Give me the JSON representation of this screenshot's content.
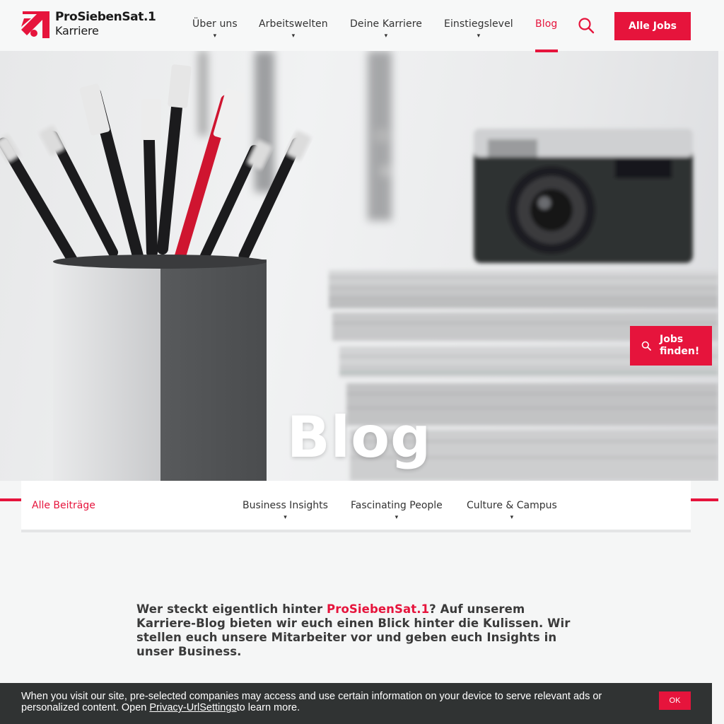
{
  "header": {
    "brand": "ProSiebenSat.1",
    "subtitle": "Karriere",
    "nav": [
      {
        "label": "Über uns",
        "caret": "▾"
      },
      {
        "label": "Arbeitswelten",
        "caret": "▾"
      },
      {
        "label": "Deine Karriere",
        "caret": "▾"
      },
      {
        "label": "Einstiegslevel",
        "caret": "▾"
      },
      {
        "label": "Blog"
      }
    ],
    "search_icon": "search-icon",
    "all_jobs": "Alle Jobs"
  },
  "hero": {
    "title": "Blog",
    "jobs_finden": "Jobs finden!"
  },
  "subnav": {
    "items": [
      {
        "label": "Alle Beiträge"
      },
      {
        "label": "Business Insights",
        "caret": "▾"
      },
      {
        "label": "Fascinating People",
        "caret": "▾"
      },
      {
        "label": "Culture & Campus",
        "caret": "▾"
      }
    ]
  },
  "intro": {
    "pre": "Wer steckt eigentlich hinter ",
    "brand": "ProSiebenSat.1",
    "post": "? Auf unserem Karriere-Blog bieten wir euch einen Blick hinter die Kulissen. Wir stellen euch unsere Mitarbeiter vor und geben euch Insights in unser Business."
  },
  "cookie": {
    "text_pre": "When you visit our site, pre-selected companies may access and use certain information on your device to serve relevant ads or personalized content. Open ",
    "link": "Privacy-UrlSettings",
    "text_post": "to learn more.",
    "ok": "OK"
  },
  "colors": {
    "accent": "#e6143c",
    "cookie_bg": "#303333",
    "header_bg": "#f7f8f8"
  }
}
